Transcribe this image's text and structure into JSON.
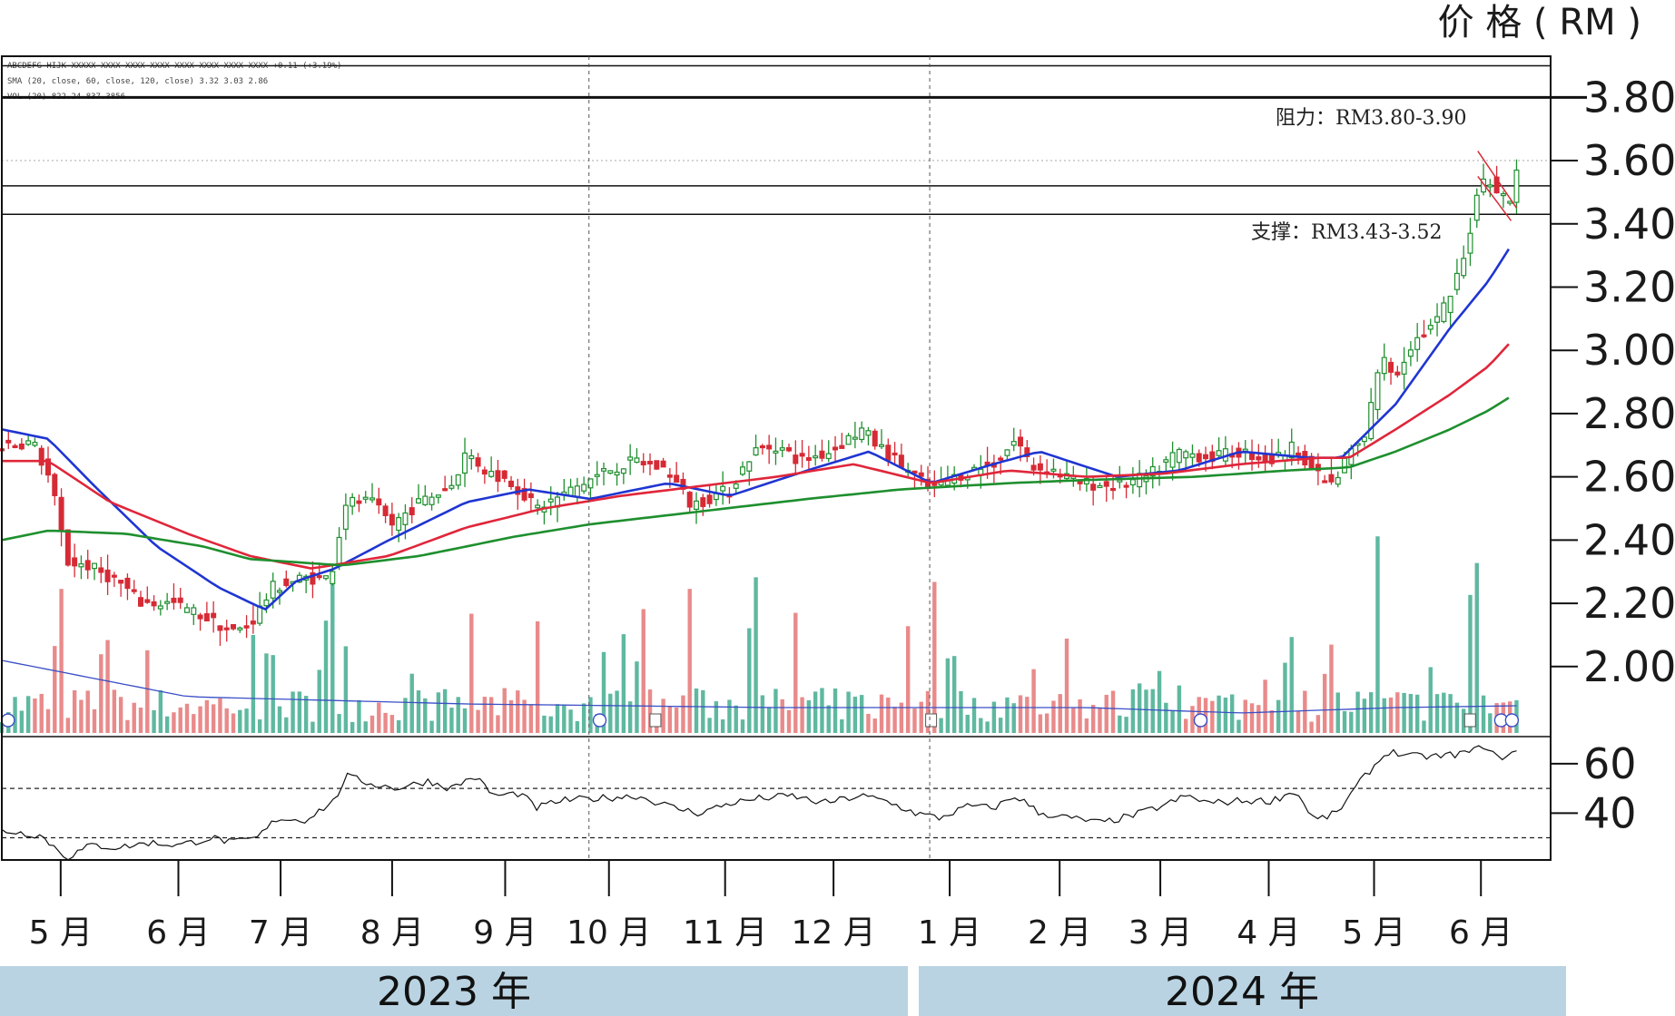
{
  "chart_data": {
    "type": "candlestick",
    "unit_label": "价 格 ( RM )",
    "header_lines": [
      "ABCDEFG HIJK XXXXX XXXX XXXX XXXX XXXX XXXX XXXX XXXX +0.11 (+3.19%)",
      "SMA (20, close, 60, close, 120, close) 3.32 3.03 2.86",
      "VOL (20) 822.24 837.3856"
    ],
    "price_axis": {
      "ticks": [
        "3.80",
        "3.60",
        "3.40",
        "3.20",
        "3.00",
        "2.80",
        "2.60",
        "2.40",
        "2.20",
        "2.00"
      ],
      "min": 1.79,
      "max": 3.93
    },
    "rsi_axis": {
      "ticks": [
        "60",
        "40"
      ],
      "overbought": 50,
      "oversold": 30,
      "min": 21,
      "max": 71
    },
    "resistance": {
      "label": "阻力：RM3.80-3.90",
      "low": 3.8,
      "high": 3.9
    },
    "support": {
      "label": "支撑：RM3.43-3.52",
      "low": 3.43,
      "high": 3.52
    },
    "dotted_level": 3.6,
    "months": [
      "5 月",
      "6 月",
      "7 月",
      "8 月",
      "9 月",
      "10 月",
      "11 月",
      "12 月",
      "1 月",
      "2 月",
      "3 月",
      "4 月",
      "5 月",
      "6 月"
    ],
    "month_tick_fraction": [
      0.038,
      0.114,
      0.18,
      0.252,
      0.325,
      0.392,
      0.467,
      0.537,
      0.612,
      0.683,
      0.748,
      0.818,
      0.886,
      0.955
    ],
    "years": [
      {
        "label": "2023 年",
        "from": "5 月",
        "to": "12 月"
      },
      {
        "label": "2024 年",
        "from": "1 月",
        "to": "6 月"
      }
    ],
    "dashed_month_markers": [
      "10 月",
      "1 月"
    ],
    "close_anchors": [
      [
        0.0,
        2.7
      ],
      [
        0.02,
        2.71
      ],
      [
        0.032,
        2.58
      ],
      [
        0.042,
        2.33
      ],
      [
        0.055,
        2.32
      ],
      [
        0.075,
        2.27
      ],
      [
        0.09,
        2.2
      ],
      [
        0.11,
        2.2
      ],
      [
        0.125,
        2.17
      ],
      [
        0.15,
        2.11
      ],
      [
        0.16,
        2.13
      ],
      [
        0.175,
        2.25
      ],
      [
        0.195,
        2.28
      ],
      [
        0.212,
        2.28
      ],
      [
        0.222,
        2.52
      ],
      [
        0.238,
        2.52
      ],
      [
        0.252,
        2.45
      ],
      [
        0.27,
        2.52
      ],
      [
        0.29,
        2.57
      ],
      [
        0.3,
        2.68
      ],
      [
        0.312,
        2.62
      ],
      [
        0.33,
        2.58
      ],
      [
        0.345,
        2.5
      ],
      [
        0.365,
        2.55
      ],
      [
        0.39,
        2.62
      ],
      [
        0.41,
        2.65
      ],
      [
        0.43,
        2.62
      ],
      [
        0.445,
        2.51
      ],
      [
        0.47,
        2.56
      ],
      [
        0.485,
        2.68
      ],
      [
        0.5,
        2.7
      ],
      [
        0.515,
        2.65
      ],
      [
        0.535,
        2.68
      ],
      [
        0.555,
        2.75
      ],
      [
        0.565,
        2.7
      ],
      [
        0.585,
        2.62
      ],
      [
        0.6,
        2.56
      ],
      [
        0.62,
        2.61
      ],
      [
        0.64,
        2.64
      ],
      [
        0.655,
        2.72
      ],
      [
        0.665,
        2.63
      ],
      [
        0.68,
        2.62
      ],
      [
        0.695,
        2.58
      ],
      [
        0.72,
        2.57
      ],
      [
        0.74,
        2.6
      ],
      [
        0.76,
        2.68
      ],
      [
        0.78,
        2.66
      ],
      [
        0.8,
        2.68
      ],
      [
        0.82,
        2.65
      ],
      [
        0.835,
        2.7
      ],
      [
        0.85,
        2.6
      ],
      [
        0.86,
        2.57
      ],
      [
        0.87,
        2.68
      ],
      [
        0.88,
        2.72
      ],
      [
        0.89,
        2.98
      ],
      [
        0.9,
        2.92
      ],
      [
        0.91,
        3.02
      ],
      [
        0.925,
        3.08
      ],
      [
        0.935,
        3.17
      ],
      [
        0.945,
        3.3
      ],
      [
        0.953,
        3.52
      ],
      [
        0.96,
        3.55
      ],
      [
        0.967,
        3.49
      ],
      [
        0.975,
        3.47
      ],
      [
        0.978,
        3.58
      ]
    ],
    "sma_lines": [
      {
        "name": "SMA 20",
        "color": "#1f35d2",
        "points": [
          [
            0.0,
            2.75
          ],
          [
            0.03,
            2.72
          ],
          [
            0.06,
            2.57
          ],
          [
            0.1,
            2.38
          ],
          [
            0.14,
            2.25
          ],
          [
            0.17,
            2.18
          ],
          [
            0.19,
            2.27
          ],
          [
            0.215,
            2.31
          ],
          [
            0.25,
            2.4
          ],
          [
            0.3,
            2.52
          ],
          [
            0.34,
            2.56
          ],
          [
            0.38,
            2.53
          ],
          [
            0.43,
            2.58
          ],
          [
            0.47,
            2.54
          ],
          [
            0.52,
            2.62
          ],
          [
            0.56,
            2.68
          ],
          [
            0.6,
            2.58
          ],
          [
            0.64,
            2.64
          ],
          [
            0.67,
            2.68
          ],
          [
            0.72,
            2.6
          ],
          [
            0.76,
            2.62
          ],
          [
            0.8,
            2.68
          ],
          [
            0.845,
            2.66
          ],
          [
            0.865,
            2.66
          ],
          [
            0.9,
            2.83
          ],
          [
            0.935,
            3.07
          ],
          [
            0.96,
            3.22
          ],
          [
            0.973,
            3.32
          ]
        ]
      },
      {
        "name": "SMA 60",
        "color": "#e0263a",
        "points": [
          [
            0.0,
            2.65
          ],
          [
            0.03,
            2.65
          ],
          [
            0.07,
            2.52
          ],
          [
            0.12,
            2.42
          ],
          [
            0.16,
            2.35
          ],
          [
            0.2,
            2.31
          ],
          [
            0.25,
            2.35
          ],
          [
            0.3,
            2.44
          ],
          [
            0.35,
            2.5
          ],
          [
            0.4,
            2.54
          ],
          [
            0.45,
            2.57
          ],
          [
            0.5,
            2.6
          ],
          [
            0.55,
            2.64
          ],
          [
            0.6,
            2.58
          ],
          [
            0.65,
            2.62
          ],
          [
            0.7,
            2.6
          ],
          [
            0.75,
            2.61
          ],
          [
            0.8,
            2.64
          ],
          [
            0.85,
            2.66
          ],
          [
            0.87,
            2.66
          ],
          [
            0.9,
            2.75
          ],
          [
            0.935,
            2.86
          ],
          [
            0.96,
            2.95
          ],
          [
            0.973,
            3.02
          ]
        ]
      },
      {
        "name": "SMA 120",
        "color": "#1e8f2e",
        "points": [
          [
            0.0,
            2.4
          ],
          [
            0.03,
            2.43
          ],
          [
            0.08,
            2.42
          ],
          [
            0.13,
            2.38
          ],
          [
            0.16,
            2.34
          ],
          [
            0.22,
            2.32
          ],
          [
            0.27,
            2.35
          ],
          [
            0.33,
            2.41
          ],
          [
            0.38,
            2.45
          ],
          [
            0.45,
            2.49
          ],
          [
            0.52,
            2.53
          ],
          [
            0.58,
            2.56
          ],
          [
            0.65,
            2.58
          ],
          [
            0.7,
            2.59
          ],
          [
            0.77,
            2.6
          ],
          [
            0.83,
            2.62
          ],
          [
            0.87,
            2.63
          ],
          [
            0.9,
            2.68
          ],
          [
            0.935,
            2.75
          ],
          [
            0.96,
            2.81
          ],
          [
            0.973,
            2.85
          ]
        ]
      }
    ],
    "volume_color_up": "#5fb8a0",
    "volume_color_down": "#e98a8a",
    "volume_spike_positions": [
      0.04,
      0.066,
      0.176,
      0.208,
      0.215,
      0.303,
      0.345,
      0.412,
      0.443,
      0.485,
      0.512,
      0.584,
      0.602,
      0.86,
      0.888,
      0.95
    ],
    "rsi_anchors": [
      [
        0.0,
        33
      ],
      [
        0.025,
        31
      ],
      [
        0.042,
        22
      ],
      [
        0.058,
        27
      ],
      [
        0.075,
        26
      ],
      [
        0.095,
        28
      ],
      [
        0.115,
        27
      ],
      [
        0.135,
        30
      ],
      [
        0.15,
        28
      ],
      [
        0.165,
        30
      ],
      [
        0.178,
        38
      ],
      [
        0.195,
        37
      ],
      [
        0.215,
        45
      ],
      [
        0.222,
        55
      ],
      [
        0.238,
        52
      ],
      [
        0.255,
        50
      ],
      [
        0.275,
        53
      ],
      [
        0.29,
        50
      ],
      [
        0.305,
        55
      ],
      [
        0.318,
        47
      ],
      [
        0.335,
        48
      ],
      [
        0.345,
        42
      ],
      [
        0.36,
        45
      ],
      [
        0.385,
        46
      ],
      [
        0.41,
        47
      ],
      [
        0.435,
        42
      ],
      [
        0.45,
        40
      ],
      [
        0.47,
        44
      ],
      [
        0.49,
        46
      ],
      [
        0.51,
        47
      ],
      [
        0.53,
        44
      ],
      [
        0.555,
        47
      ],
      [
        0.57,
        45
      ],
      [
        0.59,
        40
      ],
      [
        0.605,
        38
      ],
      [
        0.625,
        43
      ],
      [
        0.64,
        42
      ],
      [
        0.655,
        47
      ],
      [
        0.67,
        40
      ],
      [
        0.69,
        38
      ],
      [
        0.71,
        36
      ],
      [
        0.73,
        39
      ],
      [
        0.75,
        43
      ],
      [
        0.765,
        47
      ],
      [
        0.78,
        44
      ],
      [
        0.8,
        45
      ],
      [
        0.82,
        45
      ],
      [
        0.835,
        49
      ],
      [
        0.848,
        37
      ],
      [
        0.862,
        40
      ],
      [
        0.88,
        55
      ],
      [
        0.895,
        65
      ],
      [
        0.91,
        63
      ],
      [
        0.93,
        63
      ],
      [
        0.95,
        65
      ],
      [
        0.958,
        68
      ],
      [
        0.965,
        62
      ],
      [
        0.978,
        65
      ]
    ]
  }
}
